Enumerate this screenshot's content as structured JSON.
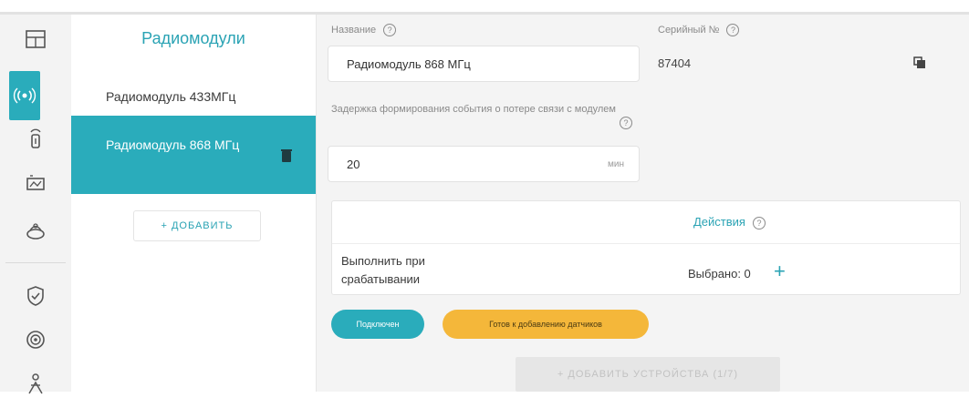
{
  "nav": {
    "icons": [
      "devices-icon",
      "radio-icon",
      "sensor-icon",
      "thermostat-icon",
      "boiler-icon",
      "shield-icon",
      "target-icon",
      "person-icon"
    ],
    "active_index": 1
  },
  "modules": {
    "title": "Радиомодули",
    "items": [
      {
        "label": "Радиомодуль 433МГц"
      },
      {
        "label": "Радиомодуль 868 МГц"
      }
    ],
    "add_label": "+  ДОБАВИТЬ"
  },
  "form": {
    "name_label": "Название",
    "name_value": "Радиомодуль 868 МГц",
    "serial_label": "Серийный №",
    "serial_value": "87404",
    "delay_label": "Задержка формирования события о потере связи с модулем",
    "delay_value": "20",
    "delay_unit": "мин",
    "help_glyph": "?"
  },
  "actions": {
    "title": "Действия",
    "row_label": "Выполнить при срабатывании",
    "selected": "Выбрано: 0",
    "add_glyph": "+"
  },
  "status": {
    "connected": "Подключен",
    "ready": "Готов к добавлению датчиков"
  },
  "add_devices_label": "+  ДОБАВИТЬ УСТРОЙСТВА (1/7)",
  "colors": {
    "accent": "#2aacbb",
    "warning": "#f4b73a",
    "disabled": "#e6e6e6"
  }
}
